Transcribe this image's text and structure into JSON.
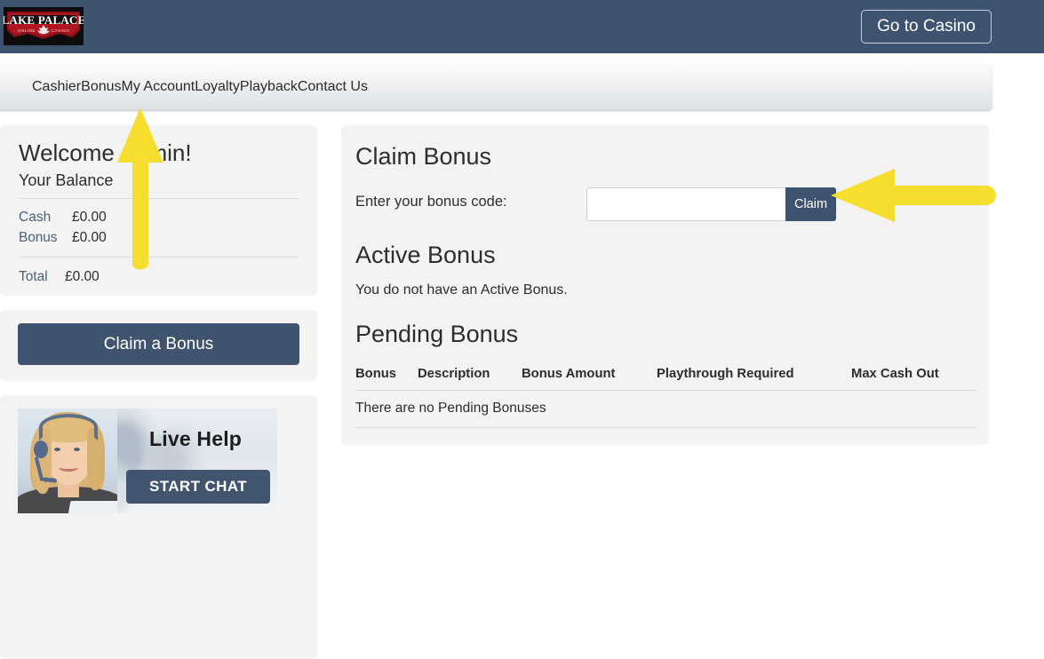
{
  "header": {
    "logo_top_text": "LAKE PALACE",
    "logo_sub_text": "ONLINE CASINO",
    "logo_icon": "maple-leaf-icon",
    "go_to_casino_label": "Go to Casino",
    "background_color": "#3e5370"
  },
  "nav": {
    "items": [
      {
        "label": "Cashier"
      },
      {
        "label": "Bonus"
      },
      {
        "label": "My Account"
      },
      {
        "label": "Loyalty"
      },
      {
        "label": "Playback"
      },
      {
        "label": "Contact Us"
      }
    ]
  },
  "sidebar": {
    "balance": {
      "welcome_title": "Welcome Admin!",
      "your_balance_label": "Your Balance",
      "rows": [
        {
          "label": "Cash",
          "value": "£0.00"
        },
        {
          "label": "Bonus",
          "value": "£0.00"
        }
      ],
      "total": {
        "label": "Total",
        "value": "£0.00"
      }
    },
    "claim_bonus_button": "Claim a Bonus",
    "live_help": {
      "title": "Live Help",
      "start_chat_label": "START CHAT",
      "agent_image": "support-agent-with-headset-photo"
    }
  },
  "main": {
    "claim_bonus": {
      "title": "Claim Bonus",
      "code_label": "Enter your bonus code:",
      "code_value": "",
      "code_placeholder": "",
      "submit_label": "Claim"
    },
    "active_bonus": {
      "title": "Active Bonus",
      "empty_message": "You do not have an Active Bonus."
    },
    "pending_bonus": {
      "title": "Pending Bonus",
      "columns": [
        "Bonus",
        "Description",
        "Bonus Amount",
        "Playthrough Required",
        "Max Cash Out"
      ],
      "empty_message": "There are no Pending Bonuses"
    }
  },
  "annotations": {
    "color": "#f5de2e",
    "arrow_up": {
      "points_to": "Bonus nav item"
    },
    "arrow_left": {
      "points_to": "Claim button"
    }
  }
}
